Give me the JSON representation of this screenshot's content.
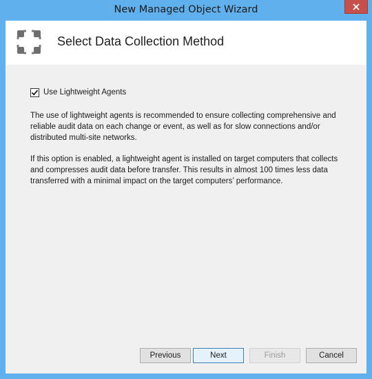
{
  "window": {
    "title": "New Managed Object Wizard",
    "close_icon": "close-icon"
  },
  "header": {
    "icon": "data-collection-icon",
    "title": "Select Data Collection Method"
  },
  "options": {
    "use_agents": {
      "label": "Use Lightweight Agents",
      "checked": true
    }
  },
  "description": {
    "paragraph1": "The use of lightweight agents is recommended to ensure collecting comprehensive and reliable audit data on each change or event, as well as for slow connections and/or distributed multi-site networks.",
    "paragraph2": "If this option is enabled, a lightweight agent is installed on target computers that collects and compresses audit data before transfer. This results in almost 100 times less data transferred with a minimal impact on the target computers’ performance."
  },
  "buttons": {
    "previous": "Previous",
    "next": "Next",
    "finish": "Finish",
    "cancel": "Cancel"
  },
  "colors": {
    "frame": "#5fb0ec",
    "close": "#c7504b",
    "client": "#f0f0f0"
  }
}
